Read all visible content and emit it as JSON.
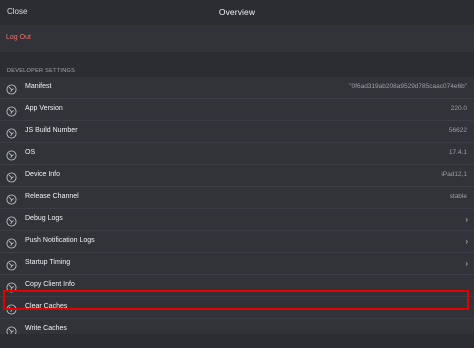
{
  "header": {
    "close_label": "Close",
    "title": "Overview"
  },
  "account": {
    "logout_label": "Log Out"
  },
  "developer": {
    "section_title": "DEVELOPER SETTINGS",
    "rows": [
      {
        "label": "Manifest",
        "value": "\"0f6ad319ab208a9529d785caac074e6b\"",
        "chevron": "",
        "icon": "wrench-icon"
      },
      {
        "label": "App Version",
        "value": "220.0",
        "chevron": "",
        "icon": "wrench-icon"
      },
      {
        "label": "JS Build Number",
        "value": "56622",
        "chevron": "",
        "icon": "wrench-icon"
      },
      {
        "label": "OS",
        "value": "17.4.1",
        "chevron": "",
        "icon": "wrench-icon"
      },
      {
        "label": "Device Info",
        "value": "iPad12,1",
        "chevron": "",
        "icon": "wrench-icon"
      },
      {
        "label": "Release Channel",
        "value": "stable",
        "chevron": "",
        "icon": "wrench-icon"
      },
      {
        "label": "Debug Logs",
        "value": "",
        "chevron": "›",
        "icon": "wrench-icon"
      },
      {
        "label": "Push Notification Logs",
        "value": "",
        "chevron": "›",
        "icon": "wrench-icon"
      },
      {
        "label": "Startup Timing",
        "value": "",
        "chevron": "›",
        "icon": "wrench-icon"
      },
      {
        "label": "Copy Client Info",
        "value": "",
        "chevron": "",
        "icon": "wrench-icon"
      },
      {
        "label": "Clear Caches",
        "value": "",
        "chevron": "",
        "icon": "wrench-icon"
      },
      {
        "label": "Write Caches",
        "value": "",
        "chevron": "",
        "icon": "wrench-icon"
      }
    ]
  },
  "colors": {
    "background": "#2b2d31",
    "row_bg": "#313338",
    "danger": "#f0726b",
    "highlight": "#e30000"
  }
}
